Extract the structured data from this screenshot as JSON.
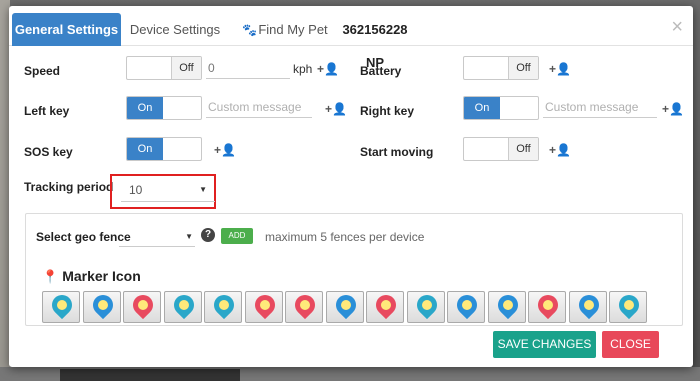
{
  "tabs": {
    "general": "General Settings",
    "device": "Device Settings",
    "pet": "Find My Pet",
    "device_id": "362156228 NP",
    "close": "×"
  },
  "settings": {
    "speed": {
      "label": "Speed",
      "toggle": "Off",
      "value": "0",
      "unit": "kph"
    },
    "battery": {
      "label": "Battery",
      "toggle": "Off"
    },
    "left_key": {
      "label": "Left key",
      "toggle": "On",
      "placeholder": "Custom message"
    },
    "right_key": {
      "label": "Right key",
      "toggle": "On",
      "placeholder": "Custom message"
    },
    "sos_key": {
      "label": "SOS key",
      "toggle": "On"
    },
    "start_moving": {
      "label": "Start moving",
      "toggle": "Off"
    },
    "tracking_period": {
      "label": "Tracking period",
      "value": "10"
    }
  },
  "add_icon": "+👤",
  "geo": {
    "label": "Select geo fence",
    "help": "?",
    "add": "ADD",
    "note": "maximum 5 fences per device"
  },
  "markers": {
    "title": "Marker Icon",
    "icons": [
      {
        "color": "#2aa7c9"
      },
      {
        "color": "#2a8fd8"
      },
      {
        "color": "#e84a5f"
      },
      {
        "color": "#2aa7c9"
      },
      {
        "color": "#2aa7c9"
      },
      {
        "color": "#e84a5f"
      },
      {
        "color": "#e84a5f"
      },
      {
        "color": "#2a8fd8"
      },
      {
        "color": "#e84a5f"
      },
      {
        "color": "#2aa7c9"
      },
      {
        "color": "#2a8fd8"
      },
      {
        "color": "#2a8fd8"
      },
      {
        "color": "#e84a5f"
      },
      {
        "color": "#2a8fd8"
      },
      {
        "color": "#2aa7c9"
      }
    ]
  },
  "footer": {
    "save": "SAVE CHANGES",
    "close": "CLOSE"
  },
  "colors": {
    "accent": "#3a82c8",
    "save": "#1aa28b",
    "close": "#e8485a",
    "add": "#4cae4c"
  }
}
